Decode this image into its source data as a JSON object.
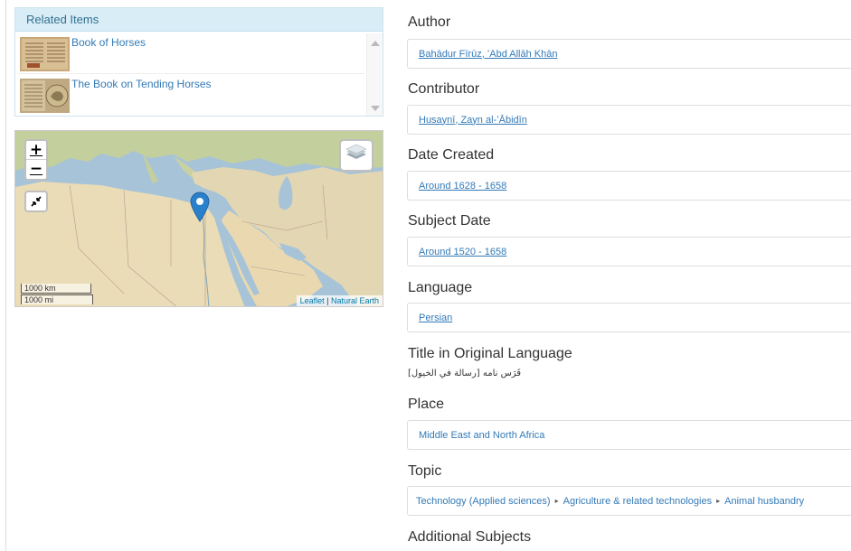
{
  "related": {
    "header": "Related Items",
    "items": [
      {
        "label": "Book of Horses"
      },
      {
        "label": "The Book on Tending Horses"
      }
    ]
  },
  "map": {
    "zoom_in": "+",
    "zoom_out": "−",
    "collapse_icon": "↙↗",
    "scale_km": "1000 km",
    "scale_mi": "1000 mi",
    "attribution_leaflet": "Leaflet",
    "attribution_sep": "|",
    "attribution_ne": "Natural Earth",
    "colors": {
      "sea": "#a7c3d8",
      "land": "#e6dcc0",
      "marker": "#2a81cb"
    }
  },
  "fields": {
    "author_label": "Author",
    "author_value": "Bahādur Fīrūz, ʻAbd Allāh Khān",
    "contributor_label": "Contributor",
    "contributor_value": "Husaynī, Zayn al-ʻĀbidīn",
    "date_created_label": "Date Created",
    "date_created_value": "Around 1628 - 1658",
    "subject_date_label": "Subject Date",
    "subject_date_value": "Around 1520 - 1658",
    "language_label": "Language",
    "language_value": "Persian",
    "title_original_label": "Title in Original Language",
    "title_original_value": "فَرَس نامه [رسالة في الخيول]",
    "place_label": "Place",
    "place_value": "Middle East and North Africa",
    "topic_label": "Topic",
    "topic_items": [
      "Technology (Applied sciences)",
      "Agriculture & related technologies",
      "Animal husbandry"
    ],
    "topic_sep": "▸",
    "additional_subjects_label": "Additional Subjects"
  }
}
